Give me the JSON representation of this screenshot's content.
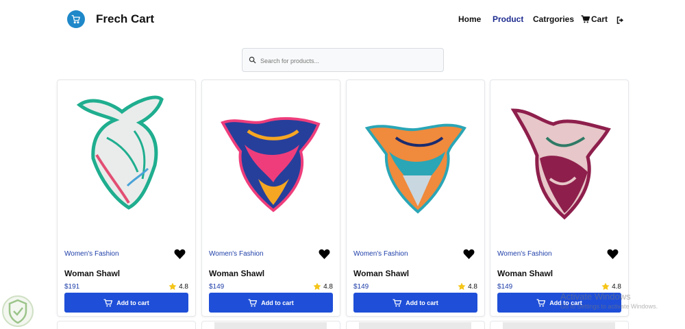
{
  "header": {
    "brand": "Frech Cart",
    "nav": {
      "home": "Home",
      "product": "Product",
      "categories": "Catrgories",
      "cart": "Cart"
    },
    "icons": [
      "cart-logo-icon",
      "cart-icon",
      "logout-icon"
    ]
  },
  "search": {
    "placeholder": "Search for products..."
  },
  "products": [
    {
      "category": "Women's Fashion",
      "name": "Woman Shawl",
      "price": "$191",
      "rating": "4.8",
      "button": "Add to cart",
      "colors": [
        "#e9ecec",
        "#1fae8f",
        "#e24f73"
      ]
    },
    {
      "category": "Women's Fashion",
      "name": "Woman Shawl",
      "price": "$149",
      "rating": "4.8",
      "button": "Add to cart",
      "colors": [
        "#263f9b",
        "#ef3d7b",
        "#f5a623"
      ]
    },
    {
      "category": "Women's Fashion",
      "name": "Woman Shawl",
      "price": "$149",
      "rating": "4.8",
      "button": "Add to cart",
      "colors": [
        "#f08a3c",
        "#2aa6b6",
        "#c9d7e0"
      ]
    },
    {
      "category": "Women's Fashion",
      "name": "Woman Shawl",
      "price": "$149",
      "rating": "4.8",
      "button": "Add to cart",
      "colors": [
        "#8e1f4c",
        "#e7c7c9",
        "#2f7a66"
      ]
    }
  ],
  "watermark": {
    "line1": "Activate Windows",
    "line2": "Go to Settings to activate Windows."
  },
  "theme": {
    "accent": "#1f4fd8",
    "brand_icon": "#1e88c9",
    "link": "#1d3da8",
    "star": "#f5c518"
  }
}
